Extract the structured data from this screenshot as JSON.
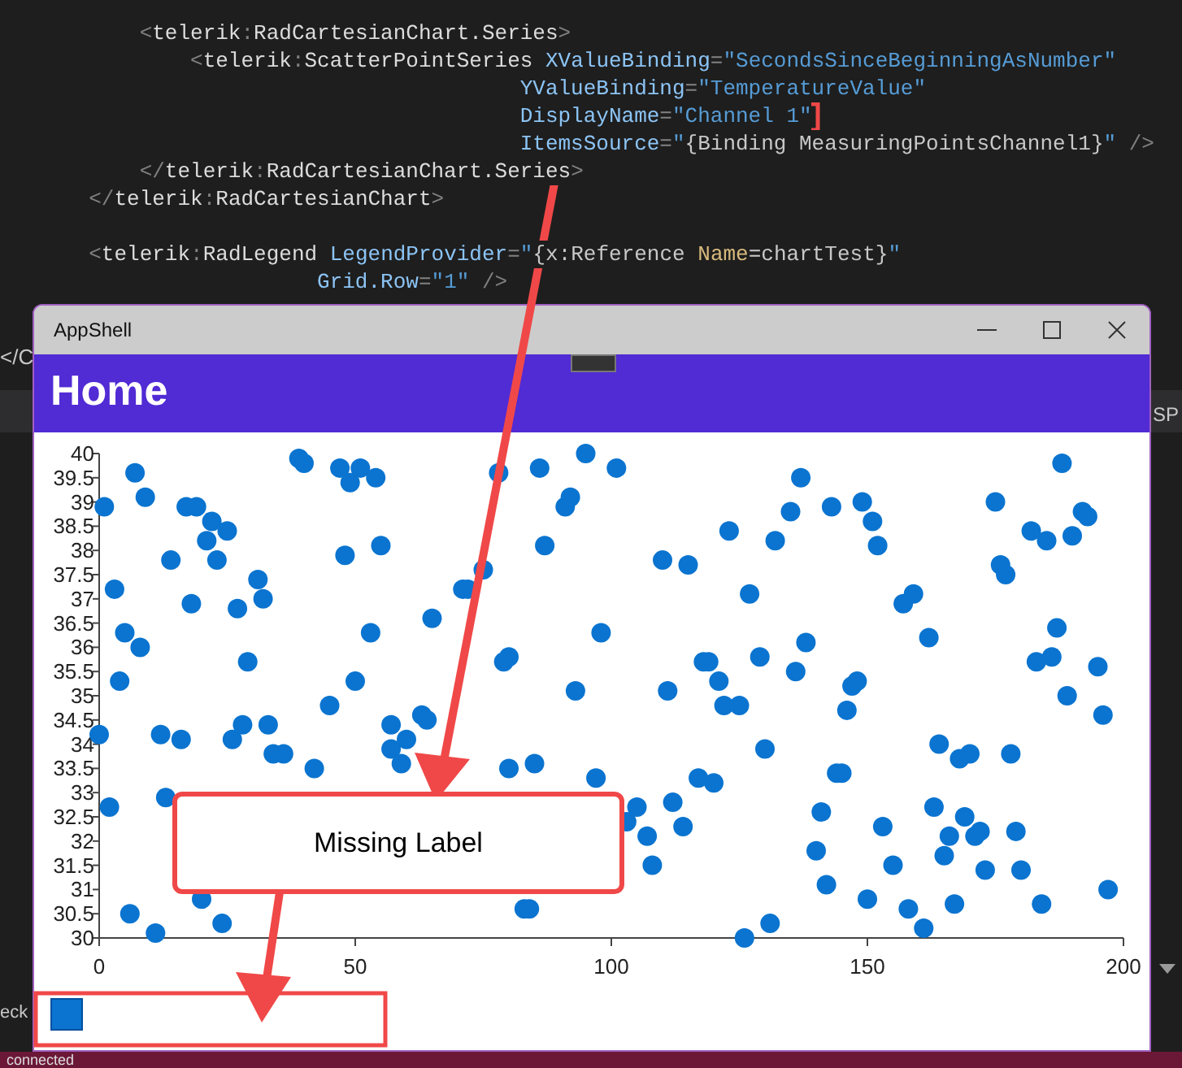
{
  "ide": {
    "code_lines": [
      {
        "tokens": [
          {
            "kind": "punct",
            "text": "           <"
          },
          {
            "kind": "tag",
            "text": "telerik"
          },
          {
            "kind": "punct",
            "text": ":"
          },
          {
            "kind": "tag",
            "text": "RadCartesianChart.Series"
          },
          {
            "kind": "punct",
            "text": ">"
          }
        ]
      },
      {
        "tokens": [
          {
            "kind": "punct",
            "text": "               <"
          },
          {
            "kind": "tag",
            "text": "telerik"
          },
          {
            "kind": "punct",
            "text": ":"
          },
          {
            "kind": "tag",
            "text": "ScatterPointSeries"
          },
          {
            "kind": "attr",
            "text": " XValueBinding"
          },
          {
            "kind": "punct",
            "text": "="
          },
          {
            "kind": "value",
            "text": "\"SecondsSinceBeginningAsNumber\""
          }
        ]
      },
      {
        "tokens": [
          {
            "kind": "attr",
            "text": "                                         YValueBinding"
          },
          {
            "kind": "punct",
            "text": "="
          },
          {
            "kind": "value",
            "text": "\"TemperatureValue\""
          }
        ]
      },
      {
        "tokens": [
          {
            "kind": "attr",
            "text": "                                         DisplayName"
          },
          {
            "kind": "punct",
            "text": "="
          },
          {
            "kind": "value",
            "text": "\"Channel 1\""
          }
        ]
      },
      {
        "tokens": [
          {
            "kind": "attr",
            "text": "                                         ItemsSource"
          },
          {
            "kind": "punct",
            "text": "="
          },
          {
            "kind": "value",
            "text": "\""
          },
          {
            "kind": "markup",
            "text": "{Binding MeasuringPointsChannel1}"
          },
          {
            "kind": "value",
            "text": "\""
          },
          {
            "kind": "punct",
            "text": " />"
          }
        ]
      },
      {
        "tokens": [
          {
            "kind": "punct",
            "text": "           </"
          },
          {
            "kind": "tag",
            "text": "telerik"
          },
          {
            "kind": "punct",
            "text": ":"
          },
          {
            "kind": "tag",
            "text": "RadCartesianChart.Series"
          },
          {
            "kind": "punct",
            "text": ">"
          }
        ]
      },
      {
        "tokens": [
          {
            "kind": "punct",
            "text": "       </"
          },
          {
            "kind": "tag",
            "text": "telerik"
          },
          {
            "kind": "punct",
            "text": ":"
          },
          {
            "kind": "tag",
            "text": "RadCartesianChart"
          },
          {
            "kind": "punct",
            "text": ">"
          }
        ]
      },
      {
        "gap_before": true,
        "tokens": [
          {
            "kind": "punct",
            "text": "       <"
          },
          {
            "kind": "tag",
            "text": "telerik"
          },
          {
            "kind": "punct",
            "text": ":"
          },
          {
            "kind": "tag",
            "text": "RadLegend"
          },
          {
            "kind": "attr",
            "text": " LegendProvider"
          },
          {
            "kind": "punct",
            "text": "="
          },
          {
            "kind": "value",
            "text": "\""
          },
          {
            "kind": "markup",
            "text": "{x:Reference "
          },
          {
            "kind": "key",
            "text": "Name"
          },
          {
            "kind": "markup",
            "text": "=chartTest}"
          },
          {
            "kind": "value",
            "text": "\""
          }
        ]
      },
      {
        "tokens": [
          {
            "kind": "attr",
            "text": "                         Grid.Row"
          },
          {
            "kind": "punct",
            "text": "="
          },
          {
            "kind": "value",
            "text": "\"1\""
          },
          {
            "kind": "punct",
            "text": " />"
          }
        ]
      }
    ],
    "left_fragment": "</C",
    "panel_fragment": "SP",
    "output_fragment": "eck"
  },
  "window": {
    "title": "AppShell",
    "header": "Home",
    "chart_data": {
      "type": "scatter",
      "xlim": [
        0,
        200
      ],
      "ylim": [
        30,
        40
      ],
      "xticks": [
        0,
        50,
        100,
        150,
        200
      ],
      "yticks": [
        {
          "value": 30,
          "label": "30"
        },
        {
          "value": 30.5,
          "label": "30.5"
        },
        {
          "value": 31,
          "label": "31"
        },
        {
          "value": 31.5,
          "label": "31.5"
        },
        {
          "value": 32,
          "label": "32"
        },
        {
          "value": 32.5,
          "label": "32.5"
        },
        {
          "value": 33,
          "label": "33"
        },
        {
          "value": 33.5,
          "label": "33.5"
        },
        {
          "value": 34,
          "label": "34"
        },
        {
          "value": 34.5,
          "label": "34.5"
        },
        {
          "value": 35,
          "label": "35"
        },
        {
          "value": 35.5,
          "label": "35.5"
        },
        {
          "value": 36,
          "label": "36"
        },
        {
          "value": 36.5,
          "label": "36.5"
        },
        {
          "value": 37,
          "label": "37"
        },
        {
          "value": 37.5,
          "label": "37.5"
        },
        {
          "value": 38,
          "label": "38"
        },
        {
          "value": 38.5,
          "label": "38.5"
        },
        {
          "value": 39,
          "label": "39"
        },
        {
          "value": 39.5,
          "label": "39.5"
        },
        {
          "value": 40,
          "label": "40"
        }
      ],
      "x": [
        0,
        1,
        2,
        3,
        4,
        5,
        6,
        7,
        8,
        9,
        11,
        12,
        13,
        14,
        16,
        17,
        18,
        19,
        21,
        22,
        23,
        24,
        25,
        26,
        27,
        28,
        29,
        31,
        32,
        33,
        34,
        36,
        39,
        40,
        42,
        45,
        47,
        48,
        49,
        50,
        51,
        53,
        54,
        55,
        57,
        57,
        59,
        60,
        63,
        64,
        65,
        71,
        72,
        75,
        78,
        79,
        80,
        80,
        83,
        84,
        85,
        86,
        87,
        91,
        92,
        93,
        95,
        97,
        98,
        101,
        103,
        105,
        107,
        108,
        110,
        111,
        112,
        114,
        115,
        117,
        118,
        119,
        120,
        121,
        122,
        123,
        125,
        126,
        127,
        129,
        130,
        131,
        132,
        135,
        136,
        137,
        138,
        140,
        141,
        142,
        143,
        144,
        145,
        146,
        147,
        148,
        149,
        150,
        151,
        152,
        153,
        155,
        157,
        158,
        159,
        161,
        162,
        163,
        164,
        165,
        166,
        167,
        168,
        169,
        170,
        171,
        172,
        173,
        175,
        176,
        177,
        178,
        179,
        180,
        182,
        183,
        184,
        185,
        186,
        187,
        188,
        189,
        190,
        192,
        193,
        195,
        196,
        197,
        20
      ],
      "series": [
        {
          "color": "#0a74d0",
          "values": [
            34.2,
            38.9,
            32.7,
            37.2,
            35.3,
            36.3,
            30.5,
            39.6,
            36,
            39.1,
            30.1,
            34.2,
            32.9,
            37.8,
            34.1,
            38.9,
            36.9,
            38.9,
            38.2,
            38.6,
            37.8,
            30.3,
            38.4,
            34.1,
            36.8,
            34.4,
            35.7,
            37.4,
            37,
            34.4,
            33.8,
            33.8,
            39.9,
            39.8,
            33.5,
            34.8,
            39.7,
            37.9,
            39.4,
            35.3,
            39.7,
            36.3,
            39.5,
            38.1,
            34.4,
            33.9,
            33.6,
            34.1,
            34.6,
            34.5,
            36.6,
            37.2,
            37.2,
            37.6,
            39.6,
            35.7,
            35.8,
            33.5,
            30.6,
            30.6,
            33.6,
            39.7,
            38.1,
            38.9,
            39.1,
            35.1,
            40,
            33.3,
            36.3,
            39.7,
            32.4,
            32.7,
            32.1,
            31.5,
            37.8,
            35.1,
            32.8,
            32.3,
            37.7,
            33.3,
            35.7,
            35.7,
            33.2,
            35.3,
            34.8,
            38.4,
            34.8,
            30,
            37.1,
            35.8,
            33.9,
            30.3,
            38.2,
            38.8,
            35.5,
            39.5,
            36.1,
            31.8,
            32.6,
            31.1,
            38.9,
            33.4,
            33.4,
            34.7,
            35.2,
            35.3,
            39,
            30.8,
            38.6,
            38.1,
            32.3,
            31.5,
            36.9,
            30.6,
            37.1,
            30.2,
            36.2,
            32.7,
            34,
            31.7,
            32.1,
            30.7,
            33.7,
            32.5,
            33.8,
            32.1,
            32.2,
            31.4,
            39,
            37.7,
            37.5,
            33.8,
            32.2,
            31.4,
            38.4,
            35.7,
            30.7,
            38.2,
            35.8,
            36.4,
            39.8,
            35,
            38.3,
            38.8,
            38.7,
            35.6,
            34.6,
            31,
            30.8
          ]
        }
      ]
    },
    "legend": {
      "items": [
        {
          "color": "#0a74d0"
        }
      ]
    }
  },
  "callout": {
    "text": "Missing Label"
  },
  "status_bar": {
    "text": "connected"
  }
}
